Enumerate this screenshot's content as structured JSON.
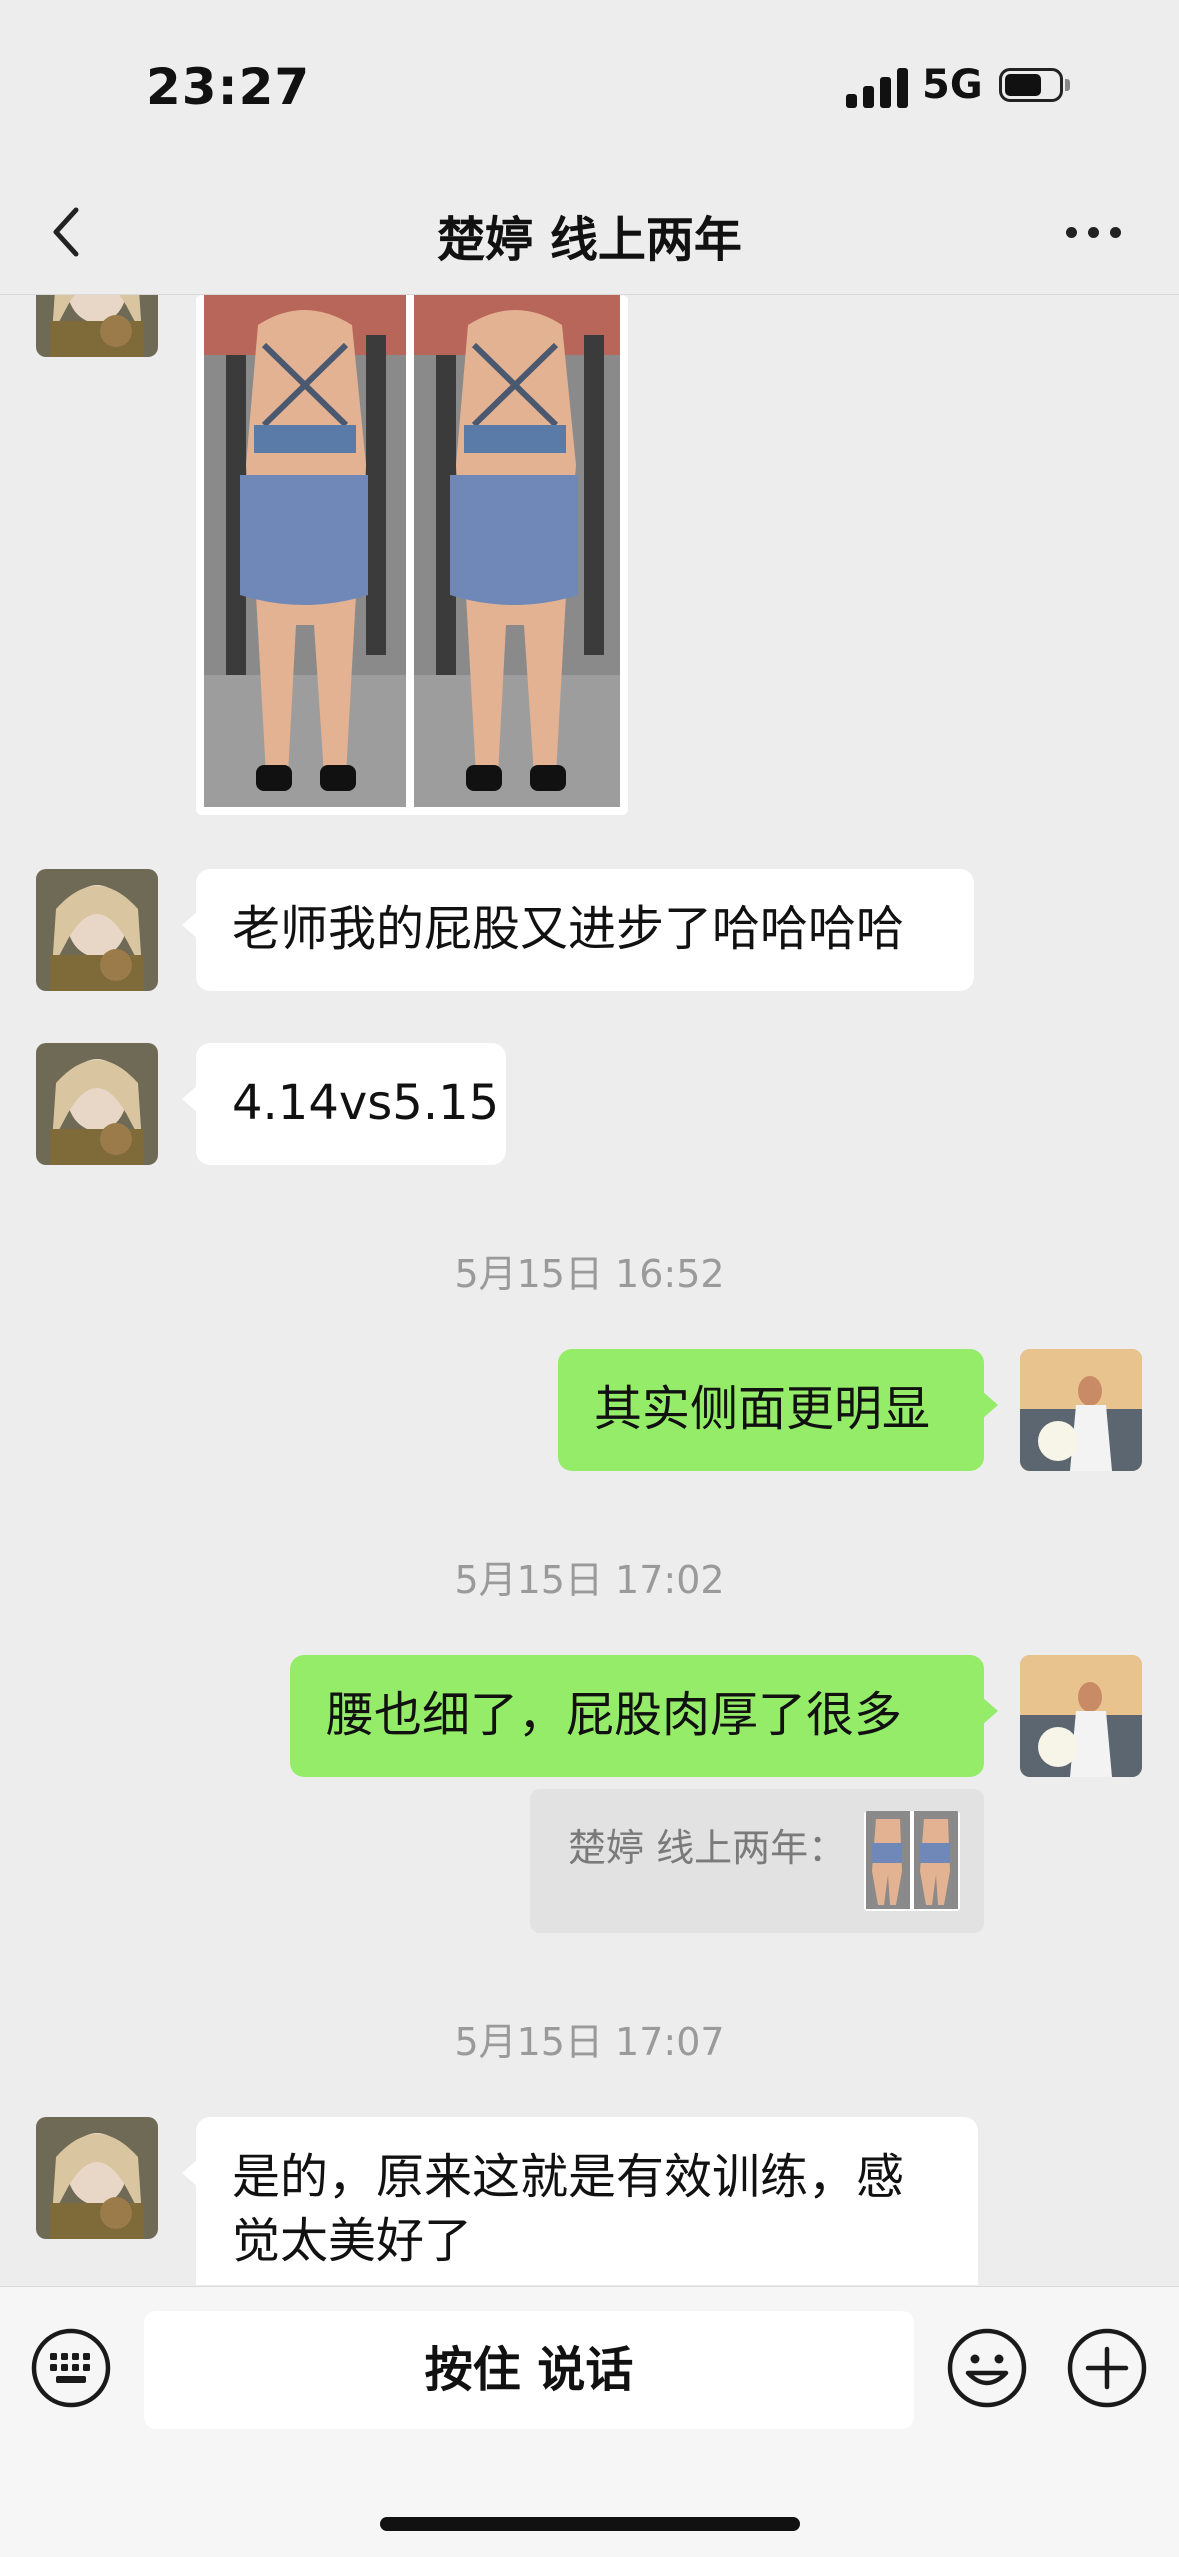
{
  "status_bar": {
    "time": "23:27",
    "network": "5G"
  },
  "nav": {
    "title": "楚婷 线上两年"
  },
  "messages": {
    "m1": "老师我的屁股又进步了哈哈哈哈",
    "m2": "4.14vs5.15",
    "t1": "5月15日 16:52",
    "m3": "其实侧面更明显",
    "t2": "5月15日 17:02",
    "m4": "腰也细了，屁股肉厚了很多",
    "quote": "楚婷 线上两年：",
    "t3": "5月15日 17:07",
    "m5": "是的，原来这就是有效训练，感觉太美好了"
  },
  "input_bar": {
    "voice_button": "按住 说话"
  },
  "colors": {
    "background": "#ededed",
    "outgoing_bubble": "#95ec69",
    "incoming_bubble": "#ffffff"
  }
}
